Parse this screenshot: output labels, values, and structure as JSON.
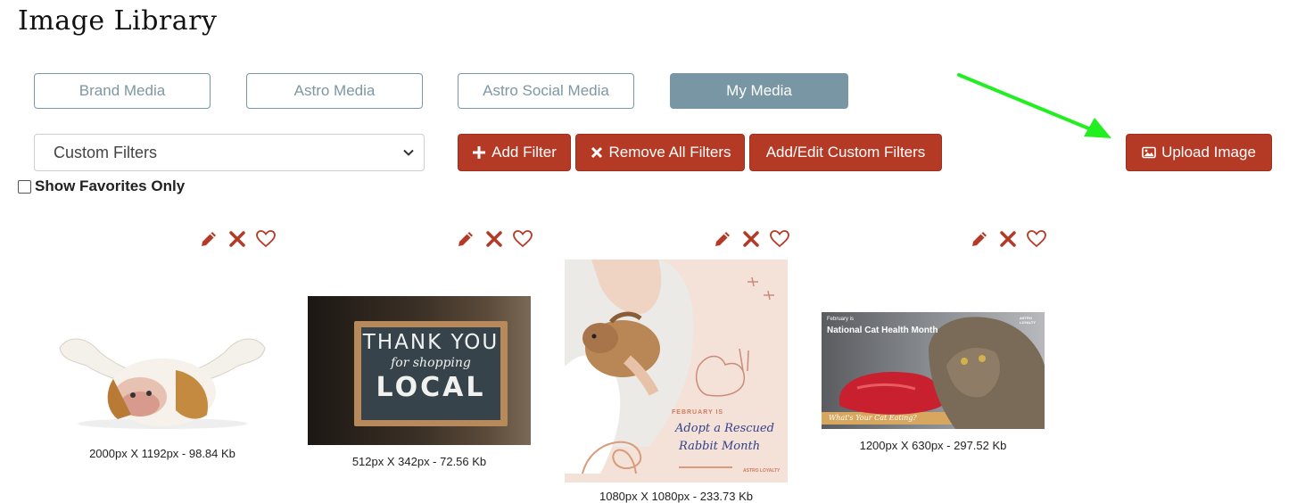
{
  "page": {
    "title": "Image Library"
  },
  "tabs": [
    {
      "label": "Brand Media",
      "active": false
    },
    {
      "label": "Astro Media",
      "active": false
    },
    {
      "label": "Astro Social Media",
      "active": false
    },
    {
      "label": "My Media",
      "active": true
    }
  ],
  "filters": {
    "select_value": "Custom Filters",
    "add_filter": "Add Filter",
    "remove_all": "Remove All Filters",
    "add_edit_custom": "Add/Edit Custom Filters",
    "upload": "Upload Image",
    "show_favorites": "Show Favorites Only"
  },
  "colors": {
    "accent": "#b53a25",
    "tab_active": "#7896a3",
    "arrow": "#22ee22"
  },
  "images": [
    {
      "caption": "2000px X 1192px - 98.84 Kb",
      "icons": [
        "edit-icon",
        "delete-icon",
        "favorite-icon"
      ]
    },
    {
      "caption": "512px X 342px - 72.56 Kb",
      "sign_line1": "THANK YOU",
      "sign_line2": "for shopping",
      "sign_line3": "LOCAL",
      "icons": [
        "edit-icon",
        "delete-icon",
        "favorite-icon"
      ]
    },
    {
      "caption": "1080px X 1080px - 233.73 Kb",
      "kicker": "FEBRUARY IS",
      "headline1": "Adopt a Rescued",
      "headline2": "Rabbit Month",
      "brand": "ASTRO LOYALTY",
      "icons": [
        "edit-icon",
        "delete-icon",
        "favorite-icon"
      ]
    },
    {
      "caption": "1200px X 630px - 297.52 Kb",
      "kicker": "February is",
      "headline": "National Cat Health Month",
      "footer": "What's Your Cat Eating?",
      "brand": "ASTRO LOYALTY",
      "icons": [
        "edit-icon",
        "delete-icon",
        "favorite-icon"
      ]
    }
  ]
}
